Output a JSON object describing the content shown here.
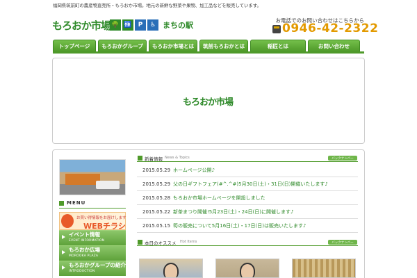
{
  "top_strip": {
    "text": "福岡県筑前町の農産物直売所・もろおか市場。地元の新鮮な野菜や果物、加工品などを販売しています。"
  },
  "header": {
    "logo_text": "もろおか市場",
    "station_icons": [
      "🌳",
      "🚻",
      "P",
      "♿"
    ],
    "station_label": "まちの駅",
    "contact_note": "お電話でのお問い合わせはこちらから",
    "phone": "0946-42-2322"
  },
  "nav": {
    "items": [
      {
        "label": "トップページ",
        "width": 62
      },
      {
        "label": "もろおかグループ",
        "width": 70
      },
      {
        "label": "もろおか市場とは",
        "width": 70
      },
      {
        "label": "筑前もろおかとは",
        "width": 70
      },
      {
        "label": "稲匠とは",
        "width": 70
      },
      {
        "label": "お問い合わせ",
        "width": 70
      }
    ]
  },
  "hero": {
    "logo_text": "もろおか市場"
  },
  "sidebar": {
    "menu_label": "MENU",
    "banner_small": "お買い得情報をお届けします",
    "banner_big": "WEBチラシ",
    "items": [
      {
        "title": "イベント情報",
        "sub": "EVENT INFORMATION"
      },
      {
        "title": "もろおか広場",
        "sub": "MOROOKA PLAZA"
      },
      {
        "title": "もろおかグループの紹介",
        "sub": "INTRODUCTION"
      }
    ]
  },
  "news": {
    "heading": "新着情報",
    "heading_en": "News & Topics",
    "more": "バックナンバー",
    "items": [
      {
        "date": "2015.05.29",
        "title": "ホームページ公開♪"
      },
      {
        "date": "2015.05.29",
        "title": "父の日ギフトフェア(#^.^#)5月30日(土)・31日(日)開催いたします♪"
      },
      {
        "date": "2015.05.28",
        "title": "もろおか市場ホームページを開設しました"
      },
      {
        "date": "2015.05.22",
        "title": "新茶まつり開催!5月23日(土)・24日(日)に開催します♪"
      },
      {
        "date": "2015.05.15",
        "title": "筍の販売について5月16日(土)・17日(日)は販売いたします♪"
      }
    ]
  },
  "hot": {
    "heading": "本日のオススメ",
    "heading_en": "Hot Items",
    "more": "バックナンバー"
  }
}
